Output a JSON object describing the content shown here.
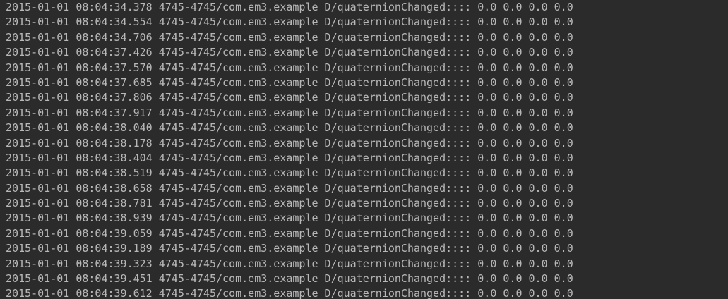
{
  "logcat": {
    "lines": [
      "2015-01-01 08:04:34.378 4745-4745/com.em3.example D/quaternionChanged:::: 0.0 0.0 0.0 0.0",
      "2015-01-01 08:04:34.554 4745-4745/com.em3.example D/quaternionChanged:::: 0.0 0.0 0.0 0.0",
      "2015-01-01 08:04:34.706 4745-4745/com.em3.example D/quaternionChanged:::: 0.0 0.0 0.0 0.0",
      "2015-01-01 08:04:37.426 4745-4745/com.em3.example D/quaternionChanged:::: 0.0 0.0 0.0 0.0",
      "2015-01-01 08:04:37.570 4745-4745/com.em3.example D/quaternionChanged:::: 0.0 0.0 0.0 0.0",
      "2015-01-01 08:04:37.685 4745-4745/com.em3.example D/quaternionChanged:::: 0.0 0.0 0.0 0.0",
      "2015-01-01 08:04:37.806 4745-4745/com.em3.example D/quaternionChanged:::: 0.0 0.0 0.0 0.0",
      "2015-01-01 08:04:37.917 4745-4745/com.em3.example D/quaternionChanged:::: 0.0 0.0 0.0 0.0",
      "2015-01-01 08:04:38.040 4745-4745/com.em3.example D/quaternionChanged:::: 0.0 0.0 0.0 0.0",
      "2015-01-01 08:04:38.178 4745-4745/com.em3.example D/quaternionChanged:::: 0.0 0.0 0.0 0.0",
      "2015-01-01 08:04:38.404 4745-4745/com.em3.example D/quaternionChanged:::: 0.0 0.0 0.0 0.0",
      "2015-01-01 08:04:38.519 4745-4745/com.em3.example D/quaternionChanged:::: 0.0 0.0 0.0 0.0",
      "2015-01-01 08:04:38.658 4745-4745/com.em3.example D/quaternionChanged:::: 0.0 0.0 0.0 0.0",
      "2015-01-01 08:04:38.781 4745-4745/com.em3.example D/quaternionChanged:::: 0.0 0.0 0.0 0.0",
      "2015-01-01 08:04:38.939 4745-4745/com.em3.example D/quaternionChanged:::: 0.0 0.0 0.0 0.0",
      "2015-01-01 08:04:39.059 4745-4745/com.em3.example D/quaternionChanged:::: 0.0 0.0 0.0 0.0",
      "2015-01-01 08:04:39.189 4745-4745/com.em3.example D/quaternionChanged:::: 0.0 0.0 0.0 0.0",
      "2015-01-01 08:04:39.323 4745-4745/com.em3.example D/quaternionChanged:::: 0.0 0.0 0.0 0.0",
      "2015-01-01 08:04:39.451 4745-4745/com.em3.example D/quaternionChanged:::: 0.0 0.0 0.0 0.0",
      "2015-01-01 08:04:39.612 4745-4745/com.em3.example D/quaternionChanged:::: 0.0 0.0 0.0 0.0"
    ]
  },
  "colors": {
    "background": "#2b2b2b",
    "text": "#b8b8b8"
  }
}
